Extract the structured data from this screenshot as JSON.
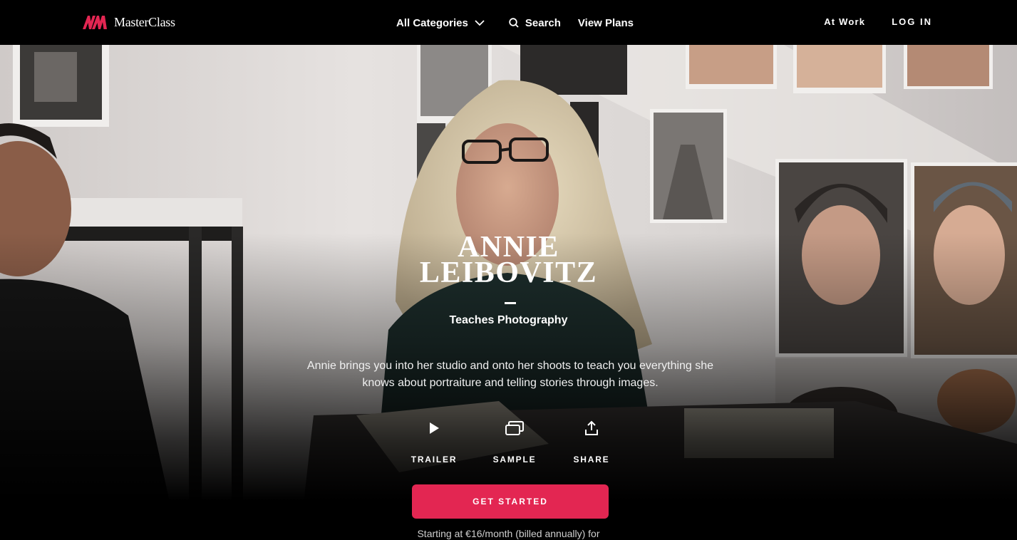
{
  "brand": {
    "name": "MasterClass",
    "accent_color": "#e32652"
  },
  "nav": {
    "categories_label": "All Categories",
    "search_label": "Search",
    "plans_label": "View Plans",
    "work_label": "At Work",
    "login_label": "LOG IN"
  },
  "hero": {
    "instructor_first": "ANNIE",
    "instructor_last": "LEIBOVITZ",
    "subject": "Teaches Photography",
    "description": "Annie brings you into her studio and onto her shoots to teach you everything she knows about portraiture and telling stories through images.",
    "actions": [
      {
        "label": "TRAILER",
        "icon": "play-icon"
      },
      {
        "label": "SAMPLE",
        "icon": "sample-icon"
      },
      {
        "label": "SHARE",
        "icon": "share-icon"
      }
    ],
    "cta_label": "GET STARTED",
    "pricing_text": "Starting at €16/month (billed annually) for"
  }
}
